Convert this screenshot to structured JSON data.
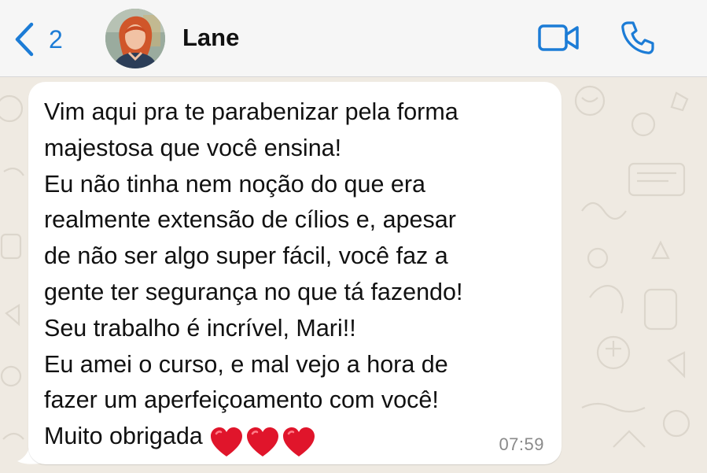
{
  "header": {
    "back_count": "2",
    "contact_name": "Lane"
  },
  "colors": {
    "accent": "#1c7cd6",
    "chat_background": "#efeae2",
    "bubble": "#ffffff",
    "heart": "#e0152b"
  },
  "message": {
    "lines": [
      "Vim aqui pra te parabenizar pela forma",
      "majestosa que você ensina!",
      "Eu não tinha nem noção do que era",
      "realmente extensão de cílios e, apesar",
      "de não ser algo super fácil, você faz a",
      "gente ter segurança no que tá fazendo!",
      "Seu trabalho é incrível, Mari!!",
      "Eu amei o curso, e mal vejo a hora de",
      "fazer um aperfeiçoamento com você!",
      "Muito obrigada"
    ],
    "heart_count": 3,
    "timestamp": "07:59"
  },
  "icons": {
    "back": "chevron-left-icon",
    "video": "video-camera-icon",
    "call": "phone-icon",
    "heart": "red-heart-icon"
  }
}
